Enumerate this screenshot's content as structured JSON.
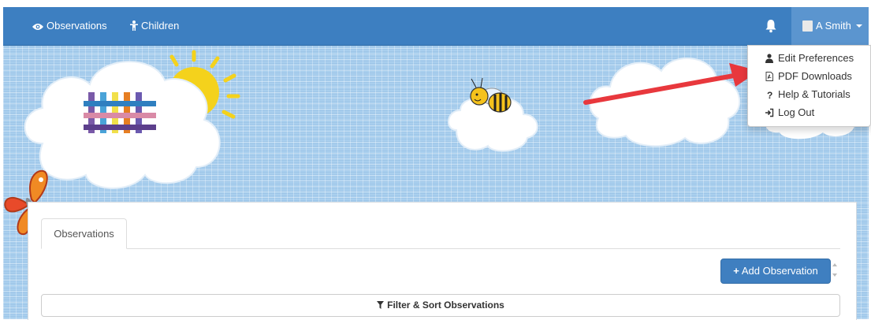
{
  "navbar": {
    "observations_label": "Observations",
    "children_label": "Children",
    "user_label": "A Smith"
  },
  "user_dropdown": {
    "items": [
      {
        "label": "Edit Preferences",
        "icon": "user-icon"
      },
      {
        "label": "PDF Downloads",
        "icon": "pdf-file-icon"
      },
      {
        "label": "Help & Tutorials",
        "icon": "question-icon"
      },
      {
        "label": "Log Out",
        "icon": "logout-icon"
      }
    ]
  },
  "main": {
    "tab_label": "Observations",
    "add_button_label": "Add Observation",
    "filter_label": "Filter & Sort Observations"
  },
  "colors": {
    "navbar": "#3d7fc1",
    "user_menu_active": "#5b95cf",
    "primary_button": "#3f7fc0",
    "background_pattern": "#a9cfee",
    "annotation_arrow": "#e8383d"
  }
}
